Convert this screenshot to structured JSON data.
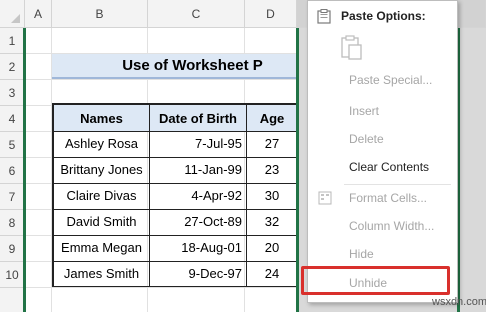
{
  "columns": [
    "A",
    "B",
    "C",
    "D"
  ],
  "rows": [
    "1",
    "2",
    "3",
    "4",
    "5",
    "6",
    "7",
    "8",
    "9",
    "10"
  ],
  "title": "Use of Worksheet P",
  "table": {
    "headers": [
      "Names",
      "Date of Birth",
      "Age"
    ],
    "rows": [
      [
        "Ashley Rosa",
        "7-Jul-95",
        "27"
      ],
      [
        "Brittany Jones",
        "11-Jan-99",
        "23"
      ],
      [
        "Claire Divas",
        "4-Apr-92",
        "30"
      ],
      [
        "David Smith",
        "27-Oct-89",
        "32"
      ],
      [
        "Emma Megan",
        "18-Aug-01",
        "20"
      ],
      [
        "James Smith",
        "9-Dec-97",
        "24"
      ]
    ]
  },
  "context_menu": {
    "paste_options_label": "Paste Options:",
    "items": [
      "Paste Special...",
      "Insert",
      "Delete",
      "Clear Contents",
      "Format Cells...",
      "Column Width...",
      "Hide",
      "Unhide"
    ]
  },
  "watermark": "wsxdn.com",
  "colors": {
    "title_fill": "#dde8f5",
    "header_fill": "#dde8f5",
    "highlight": "#d9302c",
    "selection": "#217346"
  }
}
